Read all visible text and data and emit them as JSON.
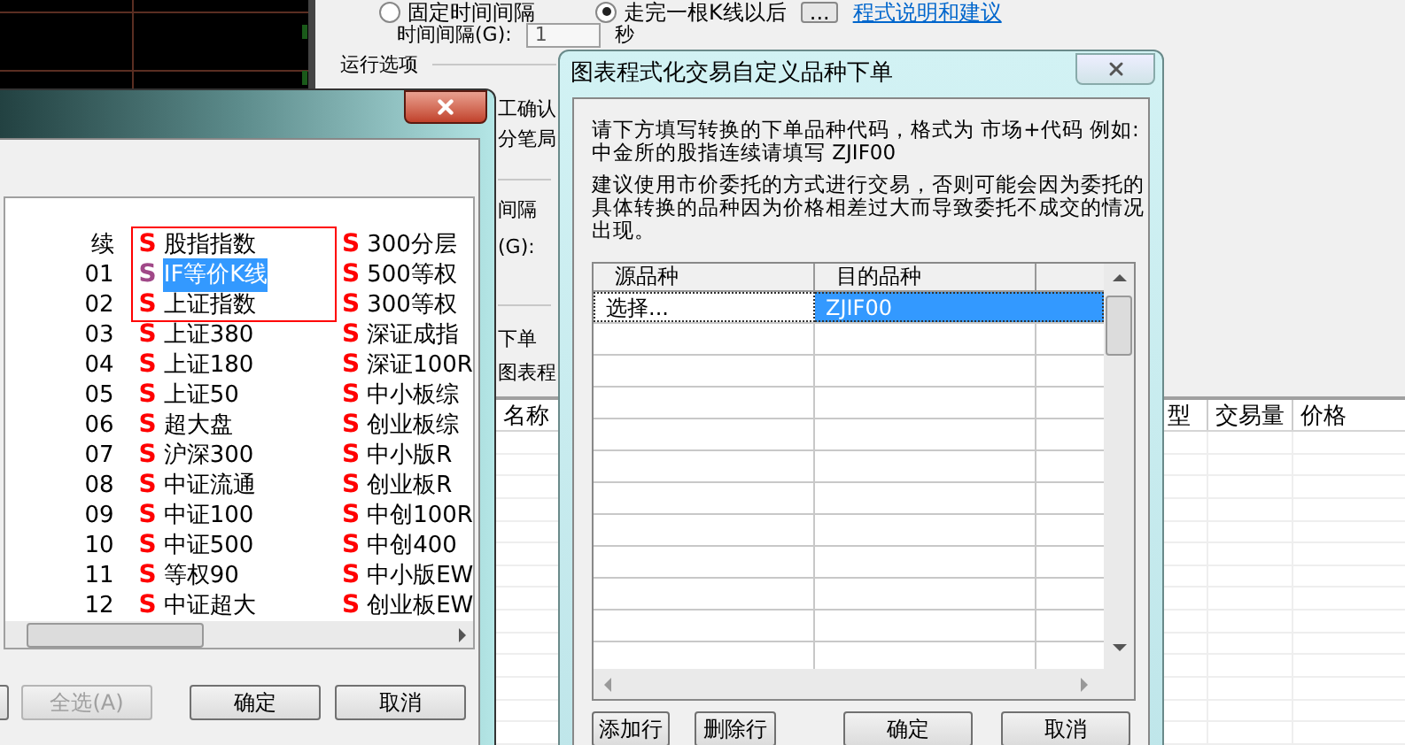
{
  "settings_window": {
    "trigger_options": [
      {
        "label": "固定时间间隔",
        "selected": false
      },
      {
        "label": "走完一根K线以后",
        "selected": true
      }
    ],
    "more_button": "...",
    "help_link": "程式说明和建议",
    "interval": {
      "label": "时间间隔(G):",
      "value": "1",
      "unit": "秒"
    },
    "run_options_title": "运行选项",
    "partial_labels": [
      "工确认",
      "分笔局",
      "间隔",
      "(G):",
      "下单",
      "图表程"
    ],
    "orders_table": {
      "columns": [
        "名称",
        "型",
        "交易量",
        "价格"
      ]
    }
  },
  "symbol_dialog": {
    "columns": [
      {
        "items": [
          {
            "label": "续",
            "selected": false
          },
          {
            "label": "01",
            "selected": false
          },
          {
            "label": "02",
            "selected": false
          },
          {
            "label": "03",
            "selected": false
          },
          {
            "label": "04",
            "selected": false
          },
          {
            "label": "05",
            "selected": false
          },
          {
            "label": "06",
            "selected": false
          },
          {
            "label": "07",
            "selected": false
          },
          {
            "label": "08",
            "selected": false
          },
          {
            "label": "09",
            "selected": false
          },
          {
            "label": "10",
            "selected": false
          },
          {
            "label": "11",
            "selected": false
          },
          {
            "label": "12",
            "selected": false
          }
        ]
      },
      {
        "items": [
          {
            "mark": "S",
            "label": "股指指数",
            "selected": false
          },
          {
            "mark": "S",
            "label": "IF等价K线",
            "selected": true
          },
          {
            "mark": "S",
            "label": "上证指数",
            "selected": false
          },
          {
            "mark": "S",
            "label": "上证380",
            "selected": false
          },
          {
            "mark": "S",
            "label": "上证180",
            "selected": false
          },
          {
            "mark": "S",
            "label": "上证50",
            "selected": false
          },
          {
            "mark": "S",
            "label": "超大盘",
            "selected": false
          },
          {
            "mark": "S",
            "label": "沪深300",
            "selected": false
          },
          {
            "mark": "S",
            "label": "中证流通",
            "selected": false
          },
          {
            "mark": "S",
            "label": "中证100",
            "selected": false
          },
          {
            "mark": "S",
            "label": "中证500",
            "selected": false
          },
          {
            "mark": "S",
            "label": "等权90",
            "selected": false
          },
          {
            "mark": "S",
            "label": "中证超大",
            "selected": false
          }
        ]
      },
      {
        "items": [
          {
            "mark": "S",
            "label": "300分层",
            "selected": false
          },
          {
            "mark": "S",
            "label": "500等权",
            "selected": false
          },
          {
            "mark": "S",
            "label": "300等权",
            "selected": false
          },
          {
            "mark": "S",
            "label": "深证成指",
            "selected": false
          },
          {
            "mark": "S",
            "label": "深证100R",
            "selected": false
          },
          {
            "mark": "S",
            "label": "中小板综",
            "selected": false
          },
          {
            "mark": "S",
            "label": "创业板综",
            "selected": false
          },
          {
            "mark": "S",
            "label": "中小版R",
            "selected": false
          },
          {
            "mark": "S",
            "label": "创业板R",
            "selected": false
          },
          {
            "mark": "S",
            "label": "中创100R",
            "selected": false
          },
          {
            "mark": "S",
            "label": "中创400",
            "selected": false
          },
          {
            "mark": "S",
            "label": "中小版EW",
            "selected": false
          },
          {
            "mark": "S",
            "label": "创业板EW",
            "selected": false
          }
        ]
      }
    ],
    "buttons": [
      {
        "label": "全选(A)",
        "disabled": true
      },
      {
        "label": "确定",
        "disabled": false
      },
      {
        "label": "取消",
        "disabled": false
      }
    ]
  },
  "mapping_dialog": {
    "title": "图表程式化交易自定义品种下单",
    "instructions": [
      "请下方填写转换的下单品种代码，格式为 市场+代码 例如:中金所的股指连续请填写 ZJIF00",
      "建议使用市价委托的方式进行交易，否则可能会因为委托的具体转换的品种因为价格相差过大而导致委托不成交的情况出现。"
    ],
    "table": {
      "columns": [
        "源品种",
        "目的品种"
      ],
      "rows": [
        {
          "source": "选择...",
          "target": "ZJIF00",
          "selected": true
        }
      ]
    },
    "buttons": [
      "添加行",
      "删除行",
      "确定",
      "取消"
    ]
  }
}
